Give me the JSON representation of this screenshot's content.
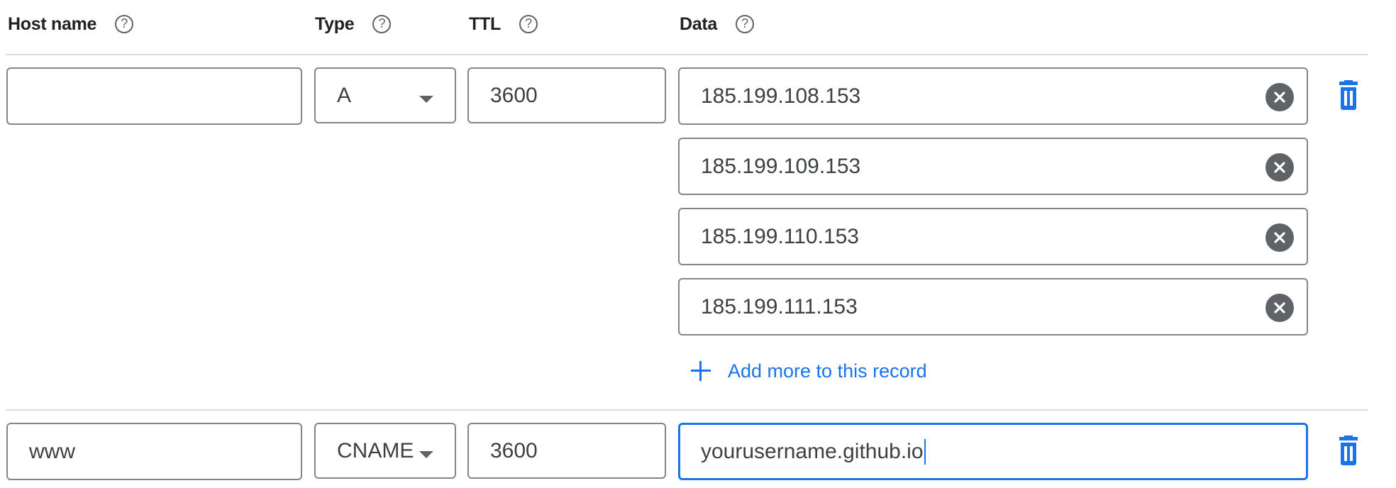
{
  "headers": {
    "host_name": "Host name",
    "type": "Type",
    "ttl": "TTL",
    "data": "Data",
    "help_glyph": "?"
  },
  "records": [
    {
      "host_name": "",
      "type": "A",
      "ttl": "3600",
      "data": [
        "185.199.108.153",
        "185.199.109.153",
        "185.199.110.153",
        "185.199.111.153"
      ],
      "add_more_label": "Add more to this record"
    },
    {
      "host_name": "www",
      "type": "CNAME",
      "ttl": "3600",
      "data": [
        "yourusername.github.io"
      ]
    }
  ],
  "icons": {
    "help": "help-circle-icon",
    "clear": "clear-circle-icon",
    "delete": "trash-icon",
    "add": "plus-icon",
    "dropdown": "caret-down-icon"
  },
  "colors": {
    "accent": "#1a73e8",
    "border": "#80868b",
    "icon_gray": "#5f6368",
    "divider": "#dadce0",
    "text": "#202124"
  }
}
